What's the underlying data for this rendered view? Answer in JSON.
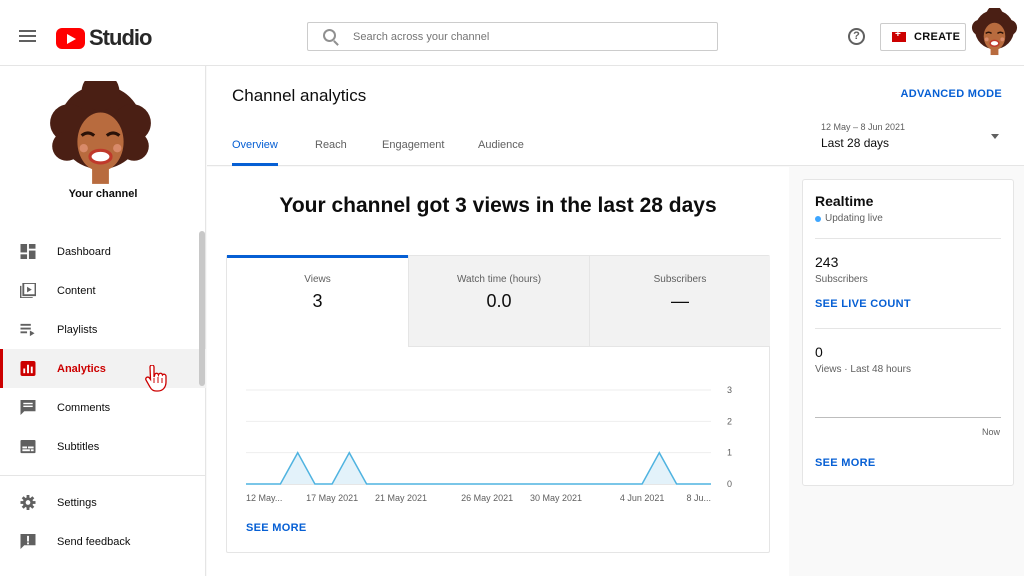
{
  "header": {
    "logo_text": "Studio",
    "search_placeholder": "Search across your channel",
    "create_label": "CREATE",
    "help_symbol": "?"
  },
  "sidebar": {
    "channel_label": "Your channel",
    "items": [
      {
        "label": "Dashboard",
        "icon": "dashboard-icon"
      },
      {
        "label": "Content",
        "icon": "content-icon"
      },
      {
        "label": "Playlists",
        "icon": "playlists-icon"
      },
      {
        "label": "Analytics",
        "icon": "analytics-icon",
        "active": true
      },
      {
        "label": "Comments",
        "icon": "comments-icon"
      },
      {
        "label": "Subtitles",
        "icon": "subtitles-icon"
      },
      {
        "label": "Settings",
        "icon": "settings-icon"
      },
      {
        "label": "Send feedback",
        "icon": "feedback-icon"
      }
    ]
  },
  "main": {
    "title": "Channel analytics",
    "advanced_mode": "ADVANCED MODE",
    "tabs": [
      {
        "label": "Overview",
        "active": true
      },
      {
        "label": "Reach"
      },
      {
        "label": "Engagement"
      },
      {
        "label": "Audience"
      }
    ],
    "date_range": "12 May – 8 Jun 2021",
    "date_period": "Last 28 days",
    "headline": "Your channel got 3 views in the last 28 days",
    "metrics": [
      {
        "label": "Views",
        "value": "3"
      },
      {
        "label": "Watch time (hours)",
        "value": "0.0"
      },
      {
        "label": "Subscribers",
        "value": "—"
      }
    ],
    "see_more": "SEE MORE"
  },
  "chart_data": {
    "type": "line",
    "x_tick_labels": [
      "12 May...",
      "17 May 2021",
      "21 May 2021",
      "26 May 2021",
      "30 May 2021",
      "4 Jun 2021",
      "8 Ju..."
    ],
    "y_ticks": [
      0,
      1,
      2,
      3
    ],
    "ylim": [
      0,
      3
    ],
    "series": [
      {
        "values": [
          0,
          0,
          0,
          1,
          0,
          0,
          1,
          0,
          0,
          0,
          0,
          0,
          0,
          0,
          0,
          0,
          0,
          0,
          0,
          0,
          0,
          0,
          0,
          0,
          1,
          0,
          0,
          0
        ]
      }
    ],
    "color": "#4fb3e0"
  },
  "realtime": {
    "title": "Realtime",
    "status": "Updating live",
    "subscribers_value": "243",
    "subscribers_label": "Subscribers",
    "see_live_count": "SEE LIVE COUNT",
    "views_value": "0",
    "views_label": "Views · Last 48 hours",
    "now_label": "Now",
    "see_more": "SEE MORE"
  }
}
